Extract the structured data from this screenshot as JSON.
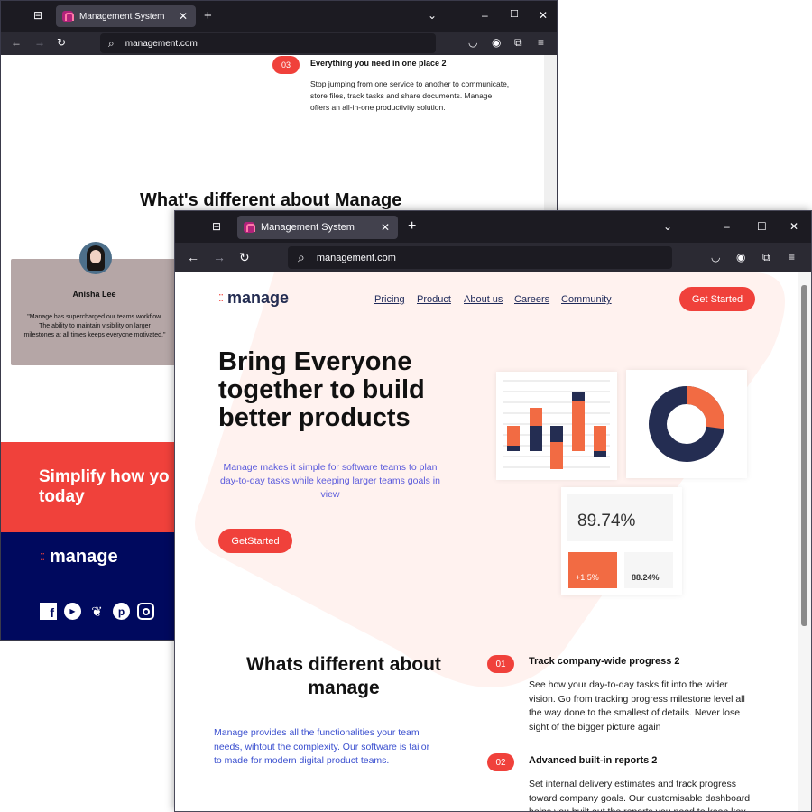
{
  "browser": {
    "tab_title": "Management System",
    "url": "management.com",
    "icons": [
      "tab-overview-icon",
      "new-tab-icon",
      "tab-list-icon",
      "minimize-icon",
      "maximize-icon",
      "close-icon",
      "back-icon",
      "forward-icon",
      "reload-icon",
      "search-icon",
      "pocket-icon",
      "account-icon",
      "extensions-icon",
      "menu-icon"
    ]
  },
  "back_window": {
    "feature": {
      "num": "03",
      "title": "Everything you need in one place 2",
      "body": "Stop jumping from one service to another to communicate, store files, track tasks and share documents. Manage offers an all-in-one productivity solution."
    },
    "section_title": "What's different about Manage",
    "testimonial": {
      "name": "Anisha Lee",
      "quote": "\"Manage has supercharged our teams workflow. The ability to maintain visibility on larger milestones at all times keeps everyone motivated.\""
    },
    "cta_text": "Simplify how yo\ntoday",
    "footer_logo": "manage",
    "social_icons": [
      "facebook-icon",
      "youtube-icon",
      "twitter-icon",
      "pinterest-icon",
      "instagram-icon"
    ]
  },
  "page": {
    "logo": "manage",
    "nav": [
      "Pricing",
      "Product",
      "About us",
      "Careers",
      "Community"
    ],
    "header_button": "Get Started",
    "hero_title": "Bring Everyone together to build better products",
    "hero_sub": "Manage makes it simple for software teams to plan day-to-day tasks while keeping larger teams goals in view",
    "hero_button": "GetStarted",
    "stats": {
      "main": "89.74%",
      "left": "+1.5%",
      "right": "88.24%"
    },
    "donut_fraction": 0.27,
    "section_title": "Whats different about manage",
    "section_body": "Manage provides all the functionalities your team needs, wihtout the complexity. Our software is tailor to made for modern digital product teams.",
    "features": [
      {
        "num": "01",
        "title": "Track company-wide progress 2",
        "body": "See how your day-to-day tasks fit into the wider vision. Go from tracking progress milestone level all the way done to the smallest of details. Never lose sight of the bigger picture again"
      },
      {
        "num": "02",
        "title": "Advanced built-in reports 2",
        "body": "Set internal delivery estimates and track progress toward company goals. Our customisable dashboard helps you built out the reports you need to keep key"
      }
    ]
  },
  "colors": {
    "accent": "#f0413b",
    "navy": "#242d52",
    "blue_text": "#3a4fcf",
    "footer": "#00095e"
  }
}
